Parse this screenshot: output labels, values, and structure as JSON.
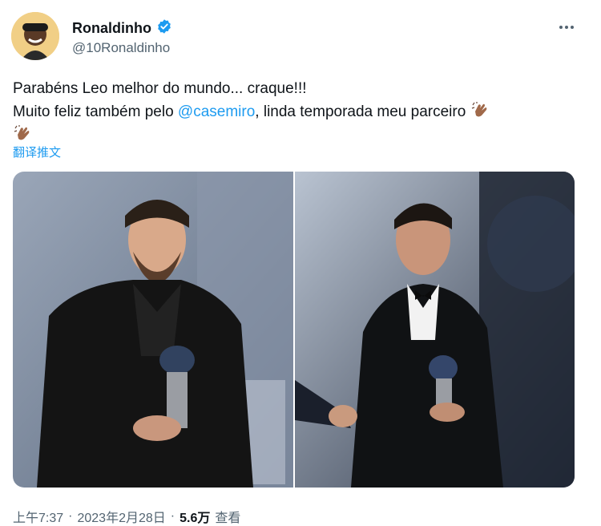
{
  "author": {
    "display_name": "Ronaldinho",
    "handle": "@10Ronaldinho"
  },
  "tweet": {
    "line1": "Parabéns Leo melhor do mundo... craque!!!",
    "line2_prefix": "Muito feliz também pelo ",
    "mention": "@casemiro",
    "line2_suffix": ", linda temporada meu parceiro",
    "translate_label": "翻译推文"
  },
  "media": {
    "photos": [
      {
        "subject": "left-photo"
      },
      {
        "subject": "right-photo"
      }
    ]
  },
  "meta": {
    "time": "上午7:37",
    "sep": "·",
    "date": "2023年2月28日",
    "sep2": "·",
    "views_count": "5.6万",
    "views_label": "查看"
  },
  "colors": {
    "link": "#1d9bf0",
    "verified": "#1d9bf0",
    "muted": "#536471"
  }
}
